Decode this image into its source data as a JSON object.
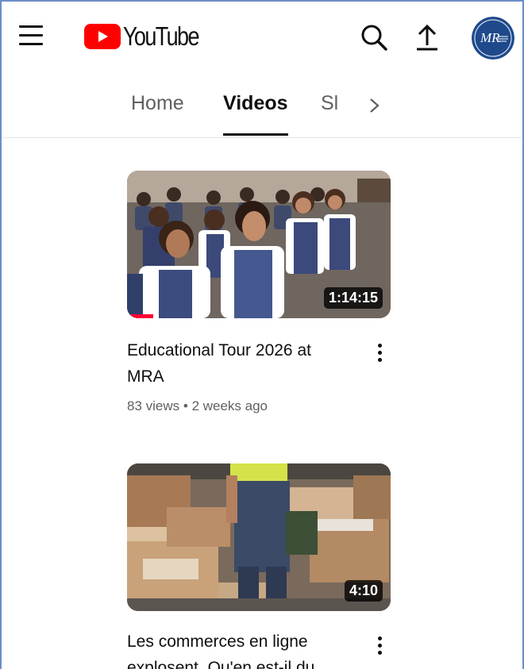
{
  "header": {
    "menu_icon": "hamburger-menu-icon",
    "logo_text": "YouTube",
    "logo_color": "#ff0000",
    "search_icon": "search-icon",
    "upload_icon": "upload-icon",
    "avatar_text": "MR"
  },
  "tabs": [
    {
      "label": "Home",
      "active": false
    },
    {
      "label": "Videos",
      "active": true
    },
    {
      "label": "Sl",
      "active": false
    }
  ],
  "tabs_more_icon": "chevron-right-icon",
  "videos": [
    {
      "title": "Educational Tour 2026 at MRA",
      "views": "83 views",
      "separator": "•",
      "age": "2 weeks ago",
      "duration": "1:14:15",
      "watched_fraction": 0.1
    },
    {
      "title": "Les commerces en ligne explosent. Qu'en est-il du...",
      "duration": "4:10"
    }
  ],
  "colors": {
    "accent": "#ff0000",
    "progress": "#ff0033",
    "text_secondary": "#606060",
    "avatar_bg": "#1e4a8c"
  }
}
